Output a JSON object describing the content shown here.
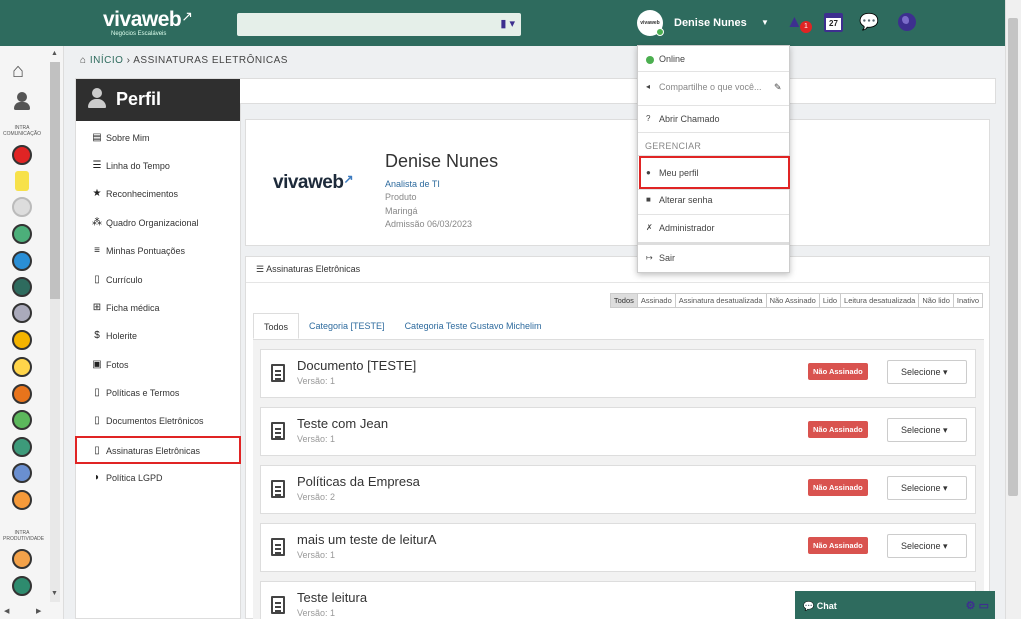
{
  "header": {
    "logo": "vivaweb",
    "logo_tagline": "Negócios Escaláveis",
    "search_placeholder": "",
    "user_name": "Denise Nunes",
    "avatar_text": "vivaweb",
    "notification_count": "1",
    "calendar_day": "27"
  },
  "leftbar": {
    "section_comunicacao": "INTRA COMUNICAÇÃO",
    "section_produtividade": "INTRA PRODUTIVIDADE"
  },
  "breadcrumb": {
    "home": "INÍCIO",
    "current": "ASSINATURAS ELETRÔNICAS"
  },
  "sidepanel": {
    "title": "Perfil",
    "items": [
      {
        "label": "Sobre Mim",
        "icon": "id-card-icon"
      },
      {
        "label": "Linha do Tempo",
        "icon": "list-icon"
      },
      {
        "label": "Reconhecimentos",
        "icon": "star-icon"
      },
      {
        "label": "Quadro Organizacional",
        "icon": "sitemap-icon"
      },
      {
        "label": "Minhas Pontuações",
        "icon": "database-icon"
      },
      {
        "label": "Currículo",
        "icon": "file-icon"
      },
      {
        "label": "Ficha médica",
        "icon": "medical-icon"
      },
      {
        "label": "Holerite",
        "icon": "dollar-icon"
      },
      {
        "label": "Fotos",
        "icon": "image-icon"
      },
      {
        "label": "Políticas e Termos",
        "icon": "file-icon"
      },
      {
        "label": "Documentos Eletrônicos",
        "icon": "file-icon"
      },
      {
        "label": "Assinaturas Eletrônicas",
        "icon": "file-icon"
      },
      {
        "label": "Política LGPD",
        "icon": "shield-icon"
      }
    ]
  },
  "profile": {
    "logo": "vivaweb",
    "name": "Denise Nunes",
    "role": "Analista de TI",
    "department": "Produto",
    "city": "Maringá",
    "admission": "Admissão 06/03/2023"
  },
  "signatures": {
    "title": "Assinaturas Eletrônicas",
    "filters": [
      "Todos",
      "Assinado",
      "Assinatura desatualizada",
      "Não Assinado",
      "Lido",
      "Leitura desatualizada",
      "Não lido",
      "Inativo"
    ],
    "tabs": [
      "Todos",
      "Categoria [TESTE]",
      "Categoria Teste Gustavo Michelim"
    ],
    "documents": [
      {
        "title": "Documento [TESTE]",
        "version": "Versão: 1",
        "status": "Não Assinado",
        "action": "Selecione"
      },
      {
        "title": "Teste com Jean",
        "version": "Versão: 1",
        "status": "Não Assinado",
        "action": "Selecione"
      },
      {
        "title": "Políticas da Empresa",
        "version": "Versão: 2",
        "status": "Não Assinado",
        "action": "Selecione"
      },
      {
        "title": "mais um teste de leiturA",
        "version": "Versão: 1",
        "status": "Não Assinado",
        "action": "Selecione"
      },
      {
        "title": "Teste leitura",
        "version": "Versão: 1",
        "status": "",
        "action": ""
      }
    ]
  },
  "dropdown": {
    "online": "Online",
    "share_placeholder": "Compartilhe o que você...",
    "open_ticket": "Abrir Chamado",
    "section": "GERENCIAR",
    "my_profile": "Meu perfil",
    "change_password": "Alterar senha",
    "admin": "Administrador",
    "logout": "Sair"
  },
  "chat": {
    "label": "Chat"
  },
  "colors": {
    "brand": "#2e6b5e",
    "accent": "#3d2f8f",
    "danger": "#d9534f",
    "highlight": "#e02424"
  }
}
